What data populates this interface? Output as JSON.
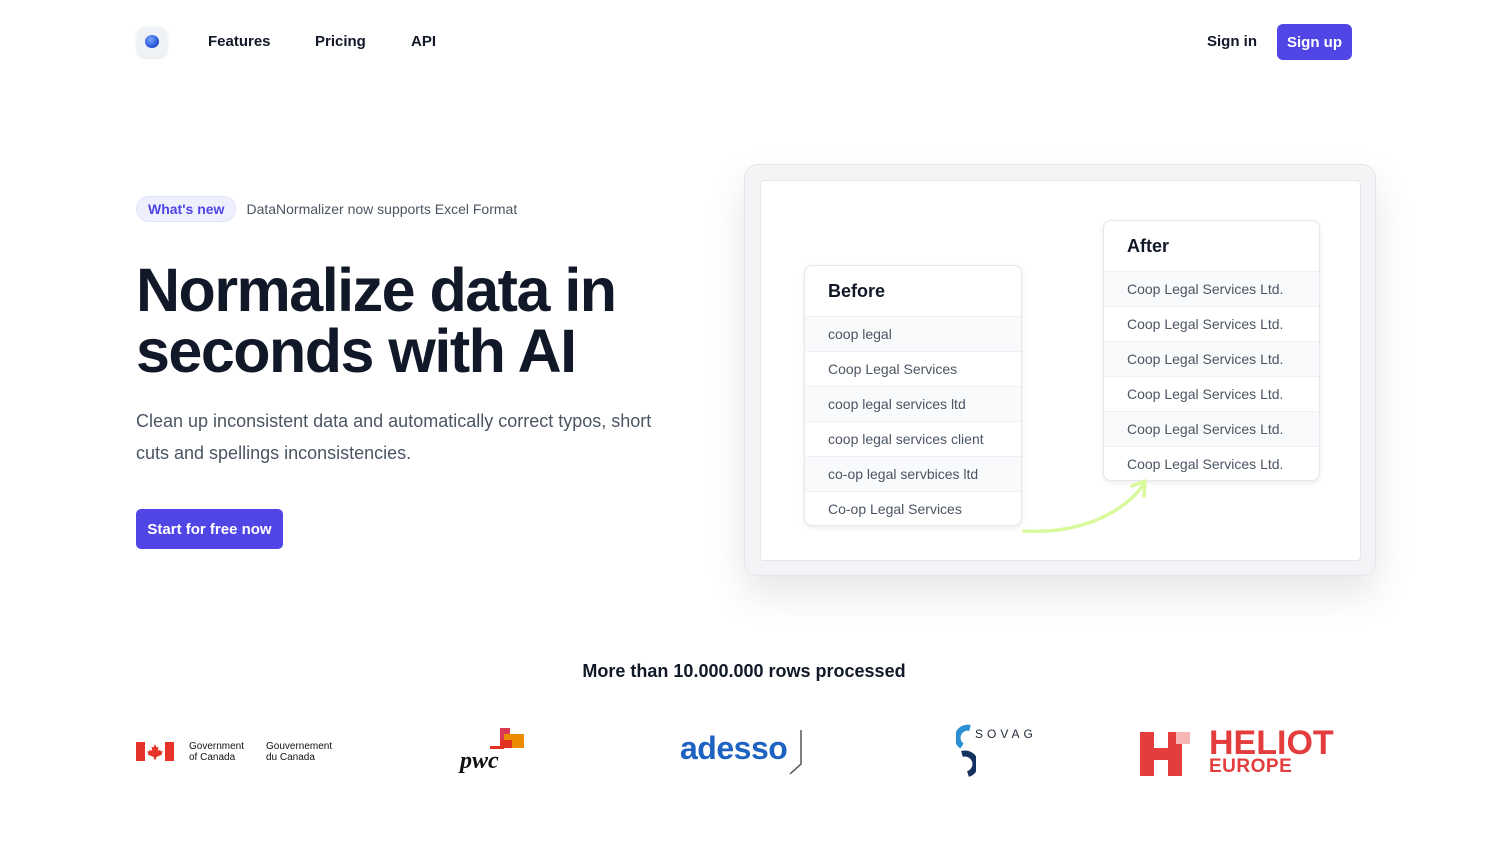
{
  "nav": {
    "links": [
      "Features",
      "Pricing",
      "API"
    ],
    "sign_in": "Sign in",
    "sign_up": "Sign up"
  },
  "hero": {
    "badge": "What's new",
    "badge_text": "DataNormalizer now supports Excel Format",
    "headline": "Normalize data in seconds with AI",
    "subtext": "Clean up inconsistent data and automatically correct typos, short cuts and spellings inconsistencies.",
    "cta": "Start for free now"
  },
  "illustration": {
    "before": {
      "title": "Before",
      "rows": [
        "coop legal",
        "Coop Legal Services",
        "coop legal services ltd",
        "coop legal services client",
        "co-op legal servbices ltd",
        "Co-op Legal Services"
      ]
    },
    "after": {
      "title": "After",
      "rows": [
        "Coop Legal Services Ltd.",
        "Coop Legal Services Ltd.",
        "Coop Legal Services Ltd.",
        "Coop Legal Services Ltd.",
        "Coop Legal Services Ltd.",
        "Coop Legal Services Ltd."
      ]
    },
    "arrow_color": "#d9f99d"
  },
  "social_proof": {
    "headline": "More than 10.000.000 rows processed",
    "logos": {
      "gc_en_1": "Government",
      "gc_en_2": "of Canada",
      "gc_fr_1": "Gouvernement",
      "gc_fr_2": "du Canada",
      "pwc": "pwc",
      "adesso": "adesso",
      "sovag": "SOVAG",
      "heliot": "HELIOT",
      "heliot_sub": "EUROPE"
    }
  },
  "colors": {
    "accent": "#4f46e5",
    "text": "#111827",
    "muted": "#4b5563"
  }
}
